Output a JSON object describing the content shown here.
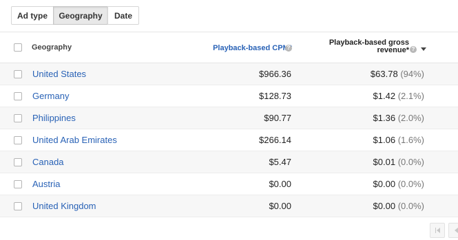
{
  "tabs": [
    {
      "label": "Ad type",
      "active": false
    },
    {
      "label": "Geography",
      "active": true
    },
    {
      "label": "Date",
      "active": false
    }
  ],
  "table": {
    "headers": {
      "geography": "Geography",
      "cpm": "Playback-based CPM*",
      "revenue_line1": "Playback-based gross",
      "revenue_line2": "revenue*"
    },
    "rows": [
      {
        "geography": "United States",
        "cpm": "$966.36",
        "revenue": "$63.78",
        "share": "(94%)"
      },
      {
        "geography": "Germany",
        "cpm": "$128.73",
        "revenue": "$1.42",
        "share": "(2.1%)"
      },
      {
        "geography": "Philippines",
        "cpm": "$90.77",
        "revenue": "$1.36",
        "share": "(2.0%)"
      },
      {
        "geography": "United Arab Emirates",
        "cpm": "$266.14",
        "revenue": "$1.06",
        "share": "(1.6%)"
      },
      {
        "geography": "Canada",
        "cpm": "$5.47",
        "revenue": "$0.01",
        "share": "(0.0%)"
      },
      {
        "geography": "Austria",
        "cpm": "$0.00",
        "revenue": "$0.00",
        "share": "(0.0%)"
      },
      {
        "geography": "United Kingdom",
        "cpm": "$0.00",
        "revenue": "$0.00",
        "share": "(0.0%)"
      }
    ]
  },
  "icons": {
    "help": "help-circle-icon",
    "sort": "sort-descending-icon",
    "pager_first": "first-page-icon",
    "pager_prev": "previous-page-icon"
  },
  "colors": {
    "link": "#2962b6",
    "row_alt": "#f7f7f7",
    "active_tab": "#e8e8e8"
  }
}
